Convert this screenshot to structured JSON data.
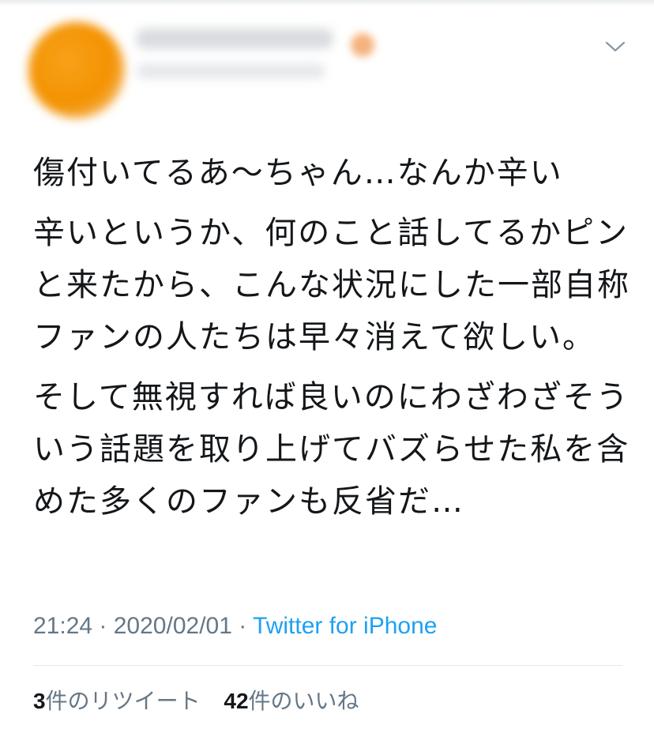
{
  "tweet": {
    "paragraphs": [
      "傷付いてるあ〜ちゃん…なんか辛い",
      "辛いというか、何のこと話してるかピンと来たから、こんな状況にした一部自称ファンの人たちは早々消えて欲しい。",
      "そして無視すれば良いのにわざわざそういう話題を取り上げてバズらせた私を含めた多くのファンも反省だ…"
    ]
  },
  "meta": {
    "time": "21:24",
    "separator": " · ",
    "date": "2020/02/01",
    "source": "Twitter for iPhone"
  },
  "stats": {
    "retweets_count": "3",
    "retweets_label": "件のリツイート",
    "likes_count": "42",
    "likes_label": "件のいいね"
  },
  "icons": {
    "menu": "chevron-down-icon"
  },
  "colors": {
    "text": "#14171a",
    "secondary": "#657786",
    "link": "#1da1f2",
    "divider": "#e1e8ed"
  }
}
